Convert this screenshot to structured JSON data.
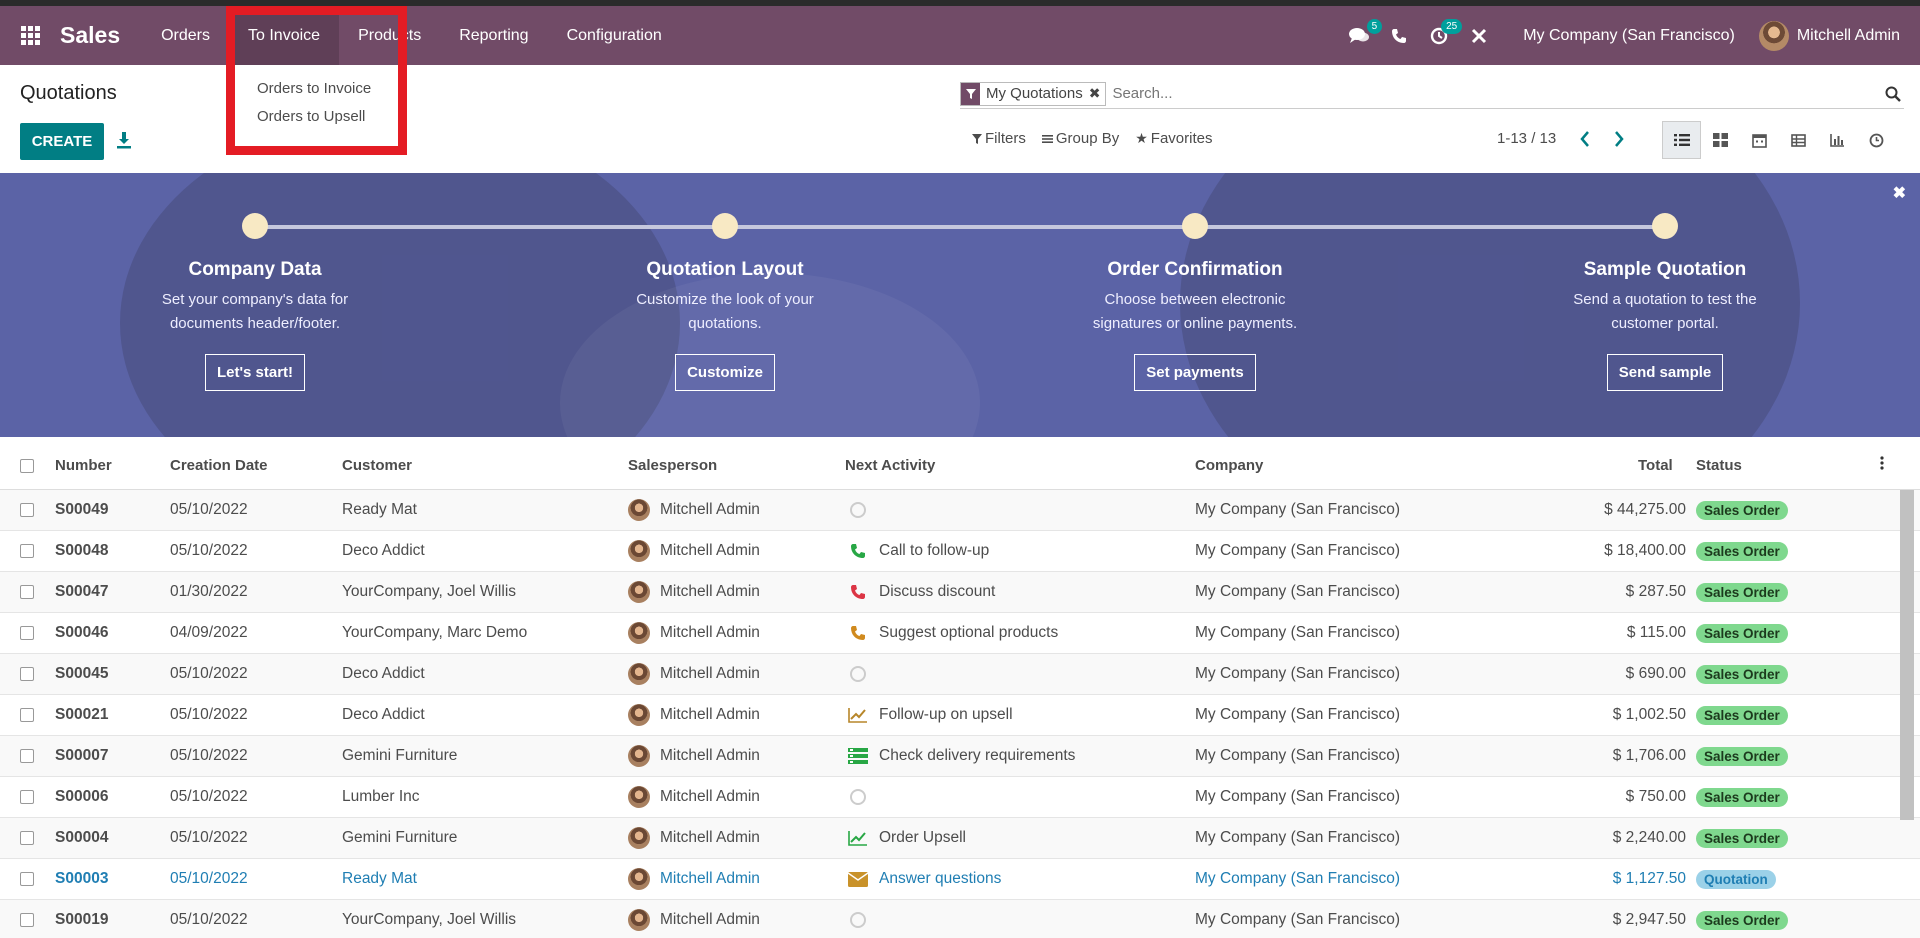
{
  "navbar": {
    "app": "Sales",
    "menu": [
      "Orders",
      "To Invoice",
      "Products",
      "Reporting",
      "Configuration"
    ],
    "messages_count": "5",
    "activities_count": "25",
    "company": "My Company (San Francisco)",
    "user": "Mitchell Admin"
  },
  "dropdown": {
    "items": [
      "Orders to Invoice",
      "Orders to Upsell"
    ]
  },
  "control_panel": {
    "title": "Quotations",
    "create": "CREATE",
    "facet": "My Quotations",
    "search_placeholder": "Search...",
    "filters": "Filters",
    "group_by": "Group By",
    "favorites": "Favorites",
    "pager": "1-13 / 13"
  },
  "banner": {
    "steps": [
      {
        "title": "Company Data",
        "line1": "Set your company's data for",
        "line2": "documents header/footer.",
        "button": "Let's start!"
      },
      {
        "title": "Quotation Layout",
        "line1": "Customize the look of your",
        "line2": "quotations.",
        "button": "Customize"
      },
      {
        "title": "Order Confirmation",
        "line1": "Choose between electronic",
        "line2": "signatures or online payments.",
        "button": "Set payments"
      },
      {
        "title": "Sample Quotation",
        "line1": "Send a quotation to test the",
        "line2": "customer portal.",
        "button": "Send sample"
      }
    ]
  },
  "table": {
    "headers": [
      "Number",
      "Creation Date",
      "Customer",
      "Salesperson",
      "Next Activity",
      "Company",
      "Total",
      "Status"
    ],
    "rows": [
      {
        "number": "S00049",
        "date": "05/10/2022",
        "customer": "Ready Mat",
        "salesperson": "Mitchell Admin",
        "activity": "",
        "company": "My Company (San Francisco)",
        "total": "$ 44,275.00",
        "status": "Sales Order"
      },
      {
        "number": "S00048",
        "date": "05/10/2022",
        "customer": "Deco Addict",
        "salesperson": "Mitchell Admin",
        "activity": "Call to follow-up",
        "company": "My Company (San Francisco)",
        "total": "$ 18,400.00",
        "status": "Sales Order"
      },
      {
        "number": "S00047",
        "date": "01/30/2022",
        "customer": "YourCompany, Joel Willis",
        "salesperson": "Mitchell Admin",
        "activity": "Discuss discount",
        "company": "My Company (San Francisco)",
        "total": "$ 287.50",
        "status": "Sales Order"
      },
      {
        "number": "S00046",
        "date": "04/09/2022",
        "customer": "YourCompany, Marc Demo",
        "salesperson": "Mitchell Admin",
        "activity": "Suggest optional products",
        "company": "My Company (San Francisco)",
        "total": "$ 115.00",
        "status": "Sales Order"
      },
      {
        "number": "S00045",
        "date": "05/10/2022",
        "customer": "Deco Addict",
        "salesperson": "Mitchell Admin",
        "activity": "",
        "company": "My Company (San Francisco)",
        "total": "$ 690.00",
        "status": "Sales Order"
      },
      {
        "number": "S00021",
        "date": "05/10/2022",
        "customer": "Deco Addict",
        "salesperson": "Mitchell Admin",
        "activity": "Follow-up on upsell",
        "company": "My Company (San Francisco)",
        "total": "$ 1,002.50",
        "status": "Sales Order"
      },
      {
        "number": "S00007",
        "date": "05/10/2022",
        "customer": "Gemini Furniture",
        "salesperson": "Mitchell Admin",
        "activity": "Check delivery requirements",
        "company": "My Company (San Francisco)",
        "total": "$ 1,706.00",
        "status": "Sales Order"
      },
      {
        "number": "S00006",
        "date": "05/10/2022",
        "customer": "Lumber Inc",
        "salesperson": "Mitchell Admin",
        "activity": "",
        "company": "My Company (San Francisco)",
        "total": "$ 750.00",
        "status": "Sales Order"
      },
      {
        "number": "S00004",
        "date": "05/10/2022",
        "customer": "Gemini Furniture",
        "salesperson": "Mitchell Admin",
        "activity": "Order Upsell",
        "company": "My Company (San Francisco)",
        "total": "$ 2,240.00",
        "status": "Sales Order"
      },
      {
        "number": "S00003",
        "date": "05/10/2022",
        "customer": "Ready Mat",
        "salesperson": "Mitchell Admin",
        "activity": "Answer questions",
        "company": "My Company (San Francisco)",
        "total": "$ 1,127.50",
        "status": "Quotation"
      },
      {
        "number": "S00019",
        "date": "05/10/2022",
        "customer": "YourCompany, Joel Willis",
        "salesperson": "Mitchell Admin",
        "activity": "",
        "company": "My Company (San Francisco)",
        "total": "$ 2,947.50",
        "status": "Sales Order"
      }
    ]
  },
  "colors": {
    "navbar": "#714b67",
    "primary": "#017e84",
    "banner": "#5b63a6",
    "highlight": "#e41c24",
    "status_sales_order": "#7fd88e",
    "status_quotation": "#9bd1e8"
  }
}
